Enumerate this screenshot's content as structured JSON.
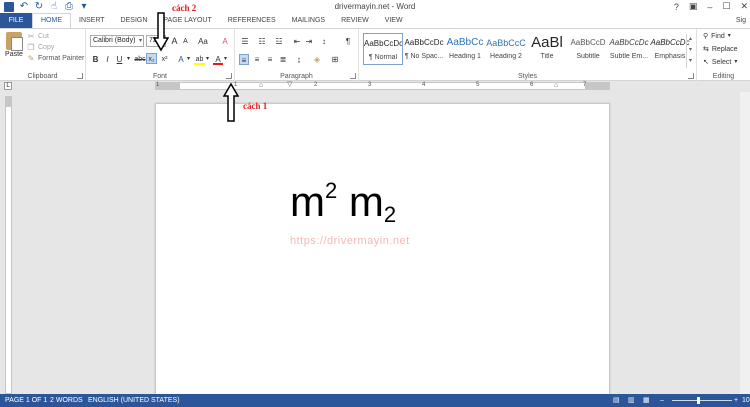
{
  "window": {
    "title": "drivermayin.net - Word",
    "signin": "Sig"
  },
  "tabs": [
    {
      "label": "FILE"
    },
    {
      "label": "HOME"
    },
    {
      "label": "INSERT"
    },
    {
      "label": "DESIGN"
    },
    {
      "label": "PAGE LAYOUT"
    },
    {
      "label": "REFERENCES"
    },
    {
      "label": "MAILINGS"
    },
    {
      "label": "REVIEW"
    },
    {
      "label": "VIEW"
    }
  ],
  "clipboard": {
    "paste": "Paste",
    "cut": "Cut",
    "copy": "Copy",
    "format_painter": "Format Painter",
    "label": "Clipboard"
  },
  "font": {
    "name": "Calibri (Body)",
    "size": "72",
    "label": "Font",
    "bold": "B",
    "italic": "I",
    "underline": "U",
    "strike": "abc",
    "subscript": "x₂",
    "superscript": "x²",
    "grow": "A",
    "shrink": "A",
    "case": "Aa",
    "clear": "A",
    "text_effects": "A",
    "highlight": "ab",
    "font_color": "A"
  },
  "paragraph": {
    "label": "Paragraph",
    "pilcrow": "¶"
  },
  "styles": {
    "label": "Styles",
    "items": [
      {
        "sample": "AaBbCcDc",
        "name": "¶ Normal"
      },
      {
        "sample": "AaBbCcDc",
        "name": "¶ No Spac..."
      },
      {
        "sample": "AaBbCc",
        "name": "Heading 1"
      },
      {
        "sample": "AaBbCcC",
        "name": "Heading 2"
      },
      {
        "sample": "AaBl",
        "name": "Title"
      },
      {
        "sample": "AaBbCcD",
        "name": "Subtitle"
      },
      {
        "sample": "AaBbCcDc",
        "name": "Subtle Em..."
      },
      {
        "sample": "AaBbCcDc",
        "name": "Emphasis"
      }
    ]
  },
  "editing": {
    "find": "Find",
    "replace": "Replace",
    "select": "Select",
    "label": "Editing"
  },
  "ruler": {
    "numbers": [
      "1",
      "1",
      "2",
      "3",
      "4",
      "5",
      "6",
      "7"
    ]
  },
  "document": {
    "base1": "m",
    "sup": "2",
    "base2": "m",
    "sub": "2",
    "watermark": "https://drivermayin.net"
  },
  "annotations": {
    "cach2": "cách 2",
    "cach1": "cách 1",
    "color": "#e31b1b"
  },
  "status": {
    "page": "PAGE 1 OF 1",
    "words": "2 WORDS",
    "language": "ENGLISH (UNITED STATES)",
    "zoom": "10"
  },
  "colors": {
    "accent": "#2b579a"
  }
}
